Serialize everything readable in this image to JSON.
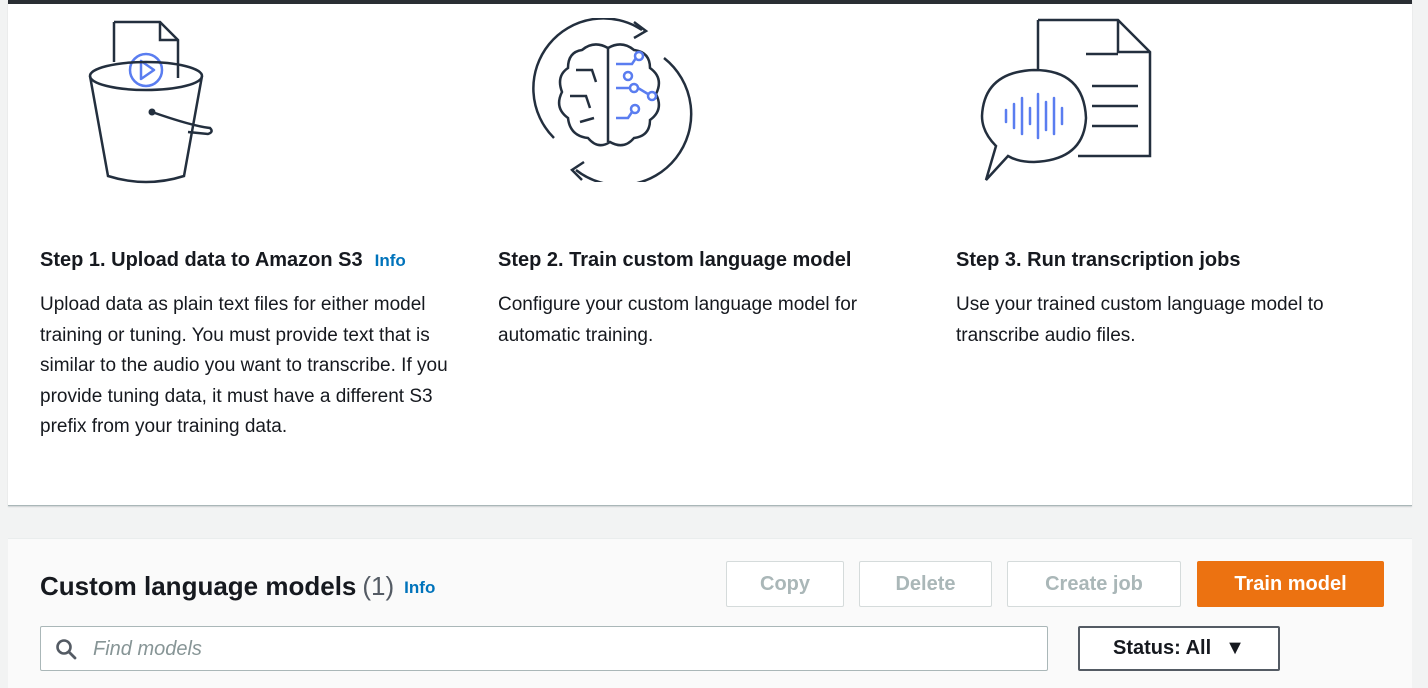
{
  "steps": [
    {
      "title": "Step 1. Upload data to Amazon S3",
      "info_label": "Info",
      "description": "Upload data as plain text files for either model training or tuning. You must provide text that is similar to the audio you want to transcribe. If you provide tuning data, it must have a different S3 prefix from your training data.",
      "icon": "s3-bucket-icon"
    },
    {
      "title": "Step 2. Train custom language model",
      "description": "Configure your custom language model for automatic training.",
      "icon": "brain-training-icon"
    },
    {
      "title": "Step 3. Run transcription jobs",
      "description": "Use your trained custom language model to transcribe audio files.",
      "icon": "transcription-document-icon"
    }
  ],
  "models": {
    "title": "Custom language models",
    "count": "(1)",
    "info_label": "Info",
    "buttons": {
      "copy": "Copy",
      "delete": "Delete",
      "create_job": "Create job",
      "train_model": "Train model"
    },
    "search": {
      "placeholder": "Find models",
      "value": ""
    },
    "status_filter": {
      "label": "Status: All",
      "caret": "▼"
    }
  },
  "colors": {
    "accent_orange": "#ec7211",
    "link_blue": "#0073bb",
    "icon_blue": "#5a7df0",
    "icon_dark": "#232f3e"
  }
}
